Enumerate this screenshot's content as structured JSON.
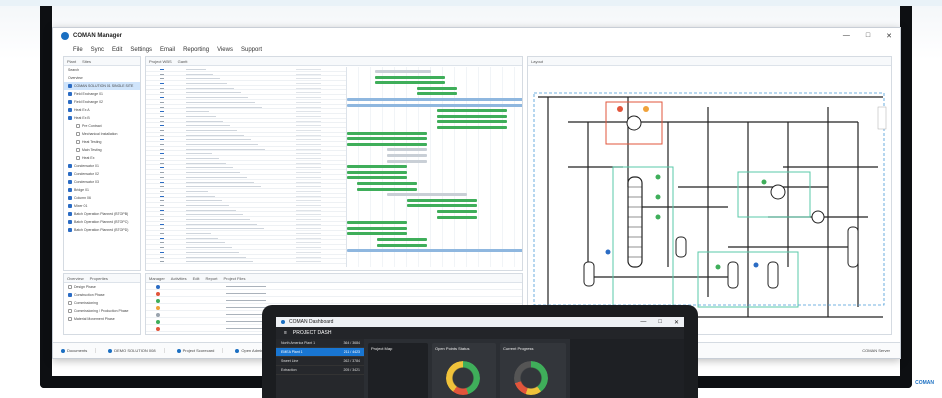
{
  "app": {
    "title": "COMAN Manager",
    "menu": [
      "File",
      "Sync",
      "Edit",
      "Settings",
      "Email",
      "Reporting",
      "Views",
      "Support"
    ],
    "window_controls": [
      "—",
      "□",
      "✕"
    ]
  },
  "left_pane": {
    "tabs": [
      "Plant",
      "Sites"
    ],
    "search_label": "Search",
    "filter_label": "Overview",
    "tree": [
      {
        "label": "COMAN SOLUTION 01 SINGLE SITE",
        "checked": true,
        "selected": true
      },
      {
        "label": "Field Exchange 01",
        "checked": true
      },
      {
        "label": "Field Exchange 02",
        "checked": true
      },
      {
        "label": "Heat Ex A",
        "checked": true
      },
      {
        "label": "Heat Ex B",
        "checked": true
      },
      {
        "label": "Pre Contract",
        "checked": false
      },
      {
        "label": "Mechanical Installation",
        "checked": false
      },
      {
        "label": "Heat Testing",
        "checked": false
      },
      {
        "label": "Main Testing",
        "checked": false
      },
      {
        "label": "Heat Ex",
        "checked": false
      },
      {
        "label": "Condensator 01",
        "checked": true
      },
      {
        "label": "Condensator 02",
        "checked": true
      },
      {
        "label": "Condensator 03",
        "checked": true
      },
      {
        "label": "Bridge 01",
        "checked": true
      },
      {
        "label": "Column 06",
        "checked": true
      },
      {
        "label": "Mixer 01",
        "checked": true
      },
      {
        "label": "Batch Operation Planned (BTOPB)",
        "checked": true
      },
      {
        "label": "Batch Operation Planned (BTOPC)",
        "checked": true
      },
      {
        "label": "Batch Operation Planned (BTOPD)",
        "checked": true
      }
    ]
  },
  "bottom_left": {
    "tabs": [
      "Overview",
      "Properties"
    ],
    "items": [
      "Design Phase",
      "Construction Phase",
      "Commissioning",
      "Commissioning / Production Phase",
      "Material Movement Phase"
    ]
  },
  "gantt": {
    "tabs": [
      "Project WBS",
      "Gantt"
    ]
  },
  "bottom_mid": {
    "tabs": [
      "Manager",
      "Activities",
      "Edit",
      "Report",
      "Project Files"
    ]
  },
  "diagram": {
    "tab": "Layout"
  },
  "taskbar": {
    "items": [
      "Documents",
      "DEMO SOLUTION 008",
      "Project Scorecard",
      "Open Admin Log"
    ],
    "right": "COMAN Server"
  },
  "dashboard": {
    "title": "COMAN Dashboard",
    "header": "PROJECT DASH",
    "sites": [
      "North America Plant 1",
      "EMEA Plant 1",
      "Sweet Line",
      "Extraction"
    ],
    "site_values": [
      "364 / 3684",
      "211 / 4423",
      "262 / 3784",
      "205 / 3421"
    ],
    "cards": [
      "Project Map",
      "Open Points Status",
      "Current Progress"
    ]
  },
  "brand": "COMAN",
  "colors": {
    "accent": "#1a6fc2",
    "gantt_bar": "#3fae5a",
    "diagram_highlight": "#e2553b",
    "diagram_zone": "#5ac8a8"
  }
}
